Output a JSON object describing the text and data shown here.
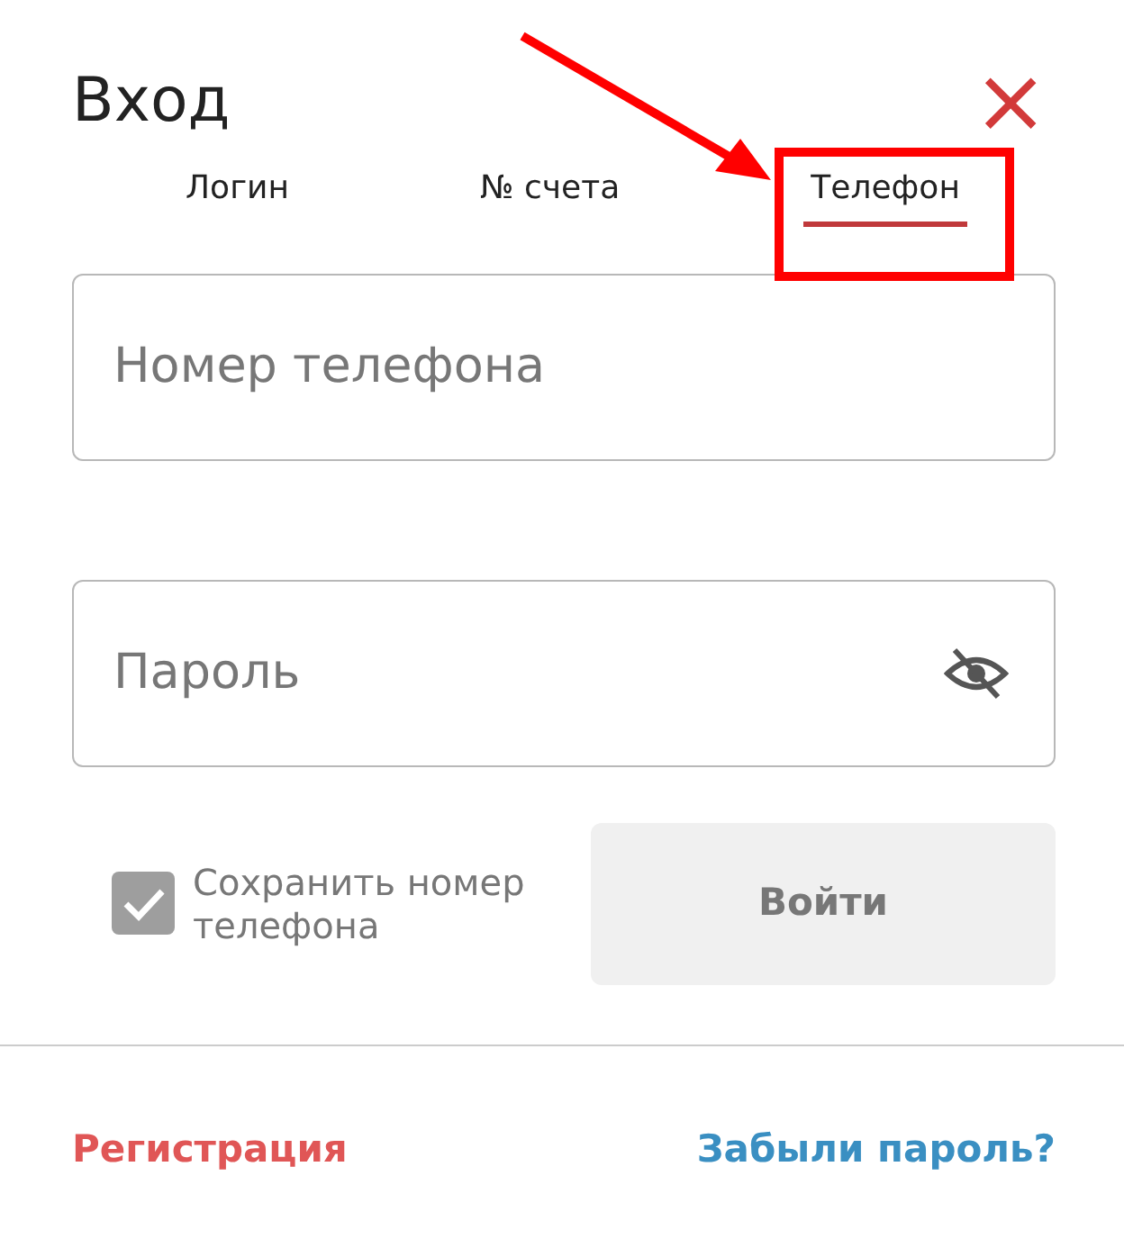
{
  "dialog": {
    "title": "Вход",
    "close": "×"
  },
  "tabs": [
    {
      "label": "Логин",
      "selected": false
    },
    {
      "label": "№ счета",
      "selected": false
    },
    {
      "label": "Телефон",
      "selected": true
    }
  ],
  "fields": [
    {
      "kind": "text",
      "placeholder": "Номер телефона"
    },
    {
      "kind": "password",
      "placeholder": "Пароль"
    }
  ],
  "remember": {
    "label": "Сохранить номер телефона",
    "checked": true
  },
  "submit": {
    "label": "Войти",
    "disabled": true
  },
  "links": [
    {
      "label": "Регистрация",
      "color": "#e05656"
    },
    {
      "label": "Забыли пароль?",
      "color": "#3a8fc2"
    }
  ]
}
